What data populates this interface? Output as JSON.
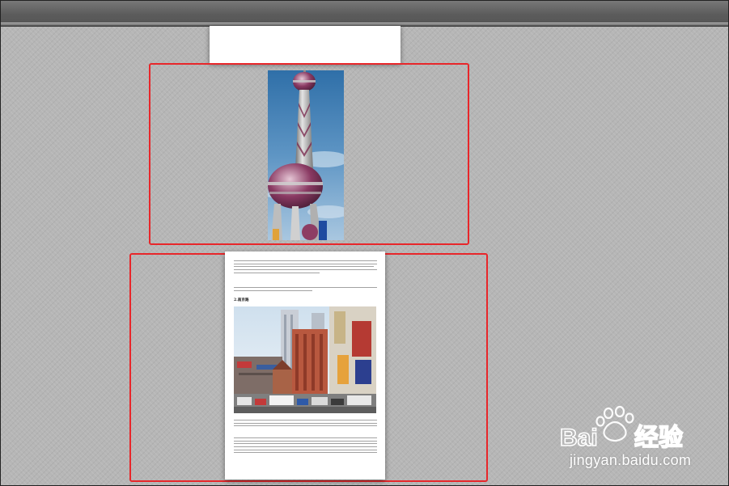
{
  "doc": {
    "section_heading": "2.南京路",
    "paragraph_lines": {
      "p1": 5,
      "p2": 3,
      "p3": 4,
      "p4": 6
    }
  },
  "watermark": {
    "brand": "Baidu经验",
    "url": "jingyan.baidu.com"
  },
  "colors": {
    "selection": "#e8262a",
    "background": "#b6b6b6",
    "topbar": "#5c5c5c"
  }
}
